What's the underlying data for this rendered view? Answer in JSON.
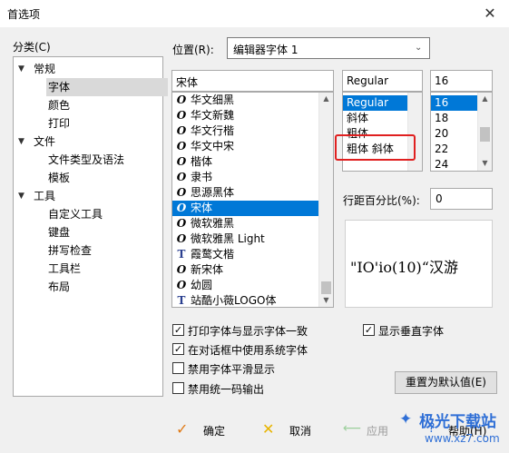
{
  "window": {
    "title": "首选项"
  },
  "category": {
    "label": "分类(C)",
    "tree": [
      {
        "label": "常规",
        "level": 0,
        "toggle": "▼"
      },
      {
        "label": "字体",
        "level": 1,
        "selected": true
      },
      {
        "label": "颜色",
        "level": 1
      },
      {
        "label": "打印",
        "level": 1
      },
      {
        "label": "文件",
        "level": 0,
        "toggle": "▼"
      },
      {
        "label": "文件类型及语法",
        "level": 1
      },
      {
        "label": "模板",
        "level": 1
      },
      {
        "label": "工具",
        "level": 0,
        "toggle": "▼"
      },
      {
        "label": "自定义工具",
        "level": 1
      },
      {
        "label": "键盘",
        "level": 1
      },
      {
        "label": "拼写检查",
        "level": 1
      },
      {
        "label": "工具栏",
        "level": 1
      },
      {
        "label": "布局",
        "level": 1
      }
    ]
  },
  "location": {
    "label": "位置(R):",
    "value": "编辑器字体 1"
  },
  "font": {
    "input": "宋体",
    "items": [
      {
        "name": "华文细黑",
        "icon": "O"
      },
      {
        "name": "华文新魏",
        "icon": "O"
      },
      {
        "name": "华文行楷",
        "icon": "O"
      },
      {
        "name": "华文中宋",
        "icon": "O"
      },
      {
        "name": "楷体",
        "icon": "O"
      },
      {
        "name": "隶书",
        "icon": "O"
      },
      {
        "name": "思源黑体",
        "icon": "O"
      },
      {
        "name": "宋体",
        "icon": "O",
        "selected": true
      },
      {
        "name": "微软雅黑",
        "icon": "O"
      },
      {
        "name": "微软雅黑 Light",
        "icon": "O"
      },
      {
        "name": "霞鹜文楷",
        "icon": "TT"
      },
      {
        "name": "新宋体",
        "icon": "O"
      },
      {
        "name": "幼圆",
        "icon": "O"
      },
      {
        "name": "站酷小薇LOGO体",
        "icon": "TT"
      }
    ]
  },
  "style": {
    "input": "Regular",
    "items": [
      {
        "name": "Regular",
        "selected": true
      },
      {
        "name": "斜体"
      },
      {
        "name": "粗体"
      },
      {
        "name": "粗体 斜体"
      }
    ],
    "highlight_color": "#e02020"
  },
  "size": {
    "input": "16",
    "items": [
      {
        "name": "16",
        "selected": true
      },
      {
        "name": "18"
      },
      {
        "name": "20"
      },
      {
        "name": "22"
      },
      {
        "name": "24"
      }
    ]
  },
  "line_spacing": {
    "label": "行距百分比(%):",
    "value": "0"
  },
  "preview": {
    "text": "\"IO'io(10)“汉游"
  },
  "checkboxes": [
    {
      "label": "打印字体与显示字体一致",
      "checked": true
    },
    {
      "label": "在对话框中使用系统字体",
      "checked": true
    },
    {
      "label": "禁用字体平滑显示",
      "checked": false
    },
    {
      "label": "禁用统一码输出",
      "checked": false
    }
  ],
  "vertical_font": {
    "label": "显示垂直字体",
    "checked": true
  },
  "buttons": {
    "reset": "重置为默认值(E)",
    "ok": "确定",
    "cancel": "取消",
    "apply": "应用",
    "help": "帮助(H)"
  },
  "watermark": {
    "site": "极光下载站",
    "url": "www.xz7.com"
  },
  "colors": {
    "selection": "#0078d7",
    "tree_selection": "#d9d9d9",
    "ok_check": "#e07a16",
    "cancel_x": "#e8b400"
  }
}
